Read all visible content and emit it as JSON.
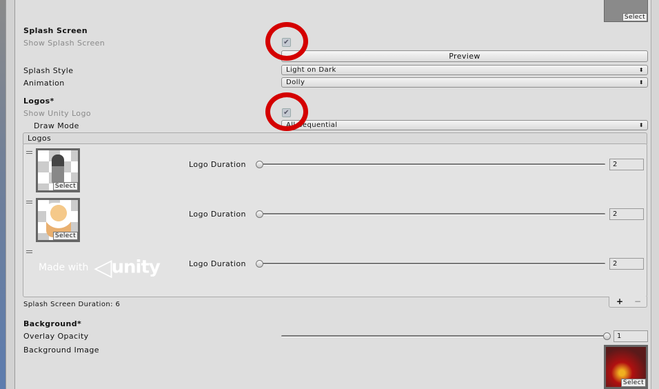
{
  "top_thumbnail": {
    "select_label": "Select"
  },
  "splash": {
    "section_title": "Splash Screen",
    "show_splash_label": "Show Splash Screen",
    "show_splash_checked": true,
    "preview_label": "Preview",
    "style_label": "Splash Style",
    "style_value": "Light on Dark",
    "animation_label": "Animation",
    "animation_value": "Dolly"
  },
  "logos": {
    "section_title": "Logos*",
    "show_unity_label": "Show Unity Logo",
    "show_unity_checked": true,
    "draw_mode_label": "Draw Mode",
    "draw_mode_value": "All Sequential",
    "list_title": "Logos",
    "items": [
      {
        "duration_label": "Logo Duration",
        "duration": "2",
        "select_label": "Select"
      },
      {
        "duration_label": "Logo Duration",
        "duration": "2",
        "select_label": "Select"
      },
      {
        "duration_label": "Logo Duration",
        "duration": "2",
        "logo_text": "Made with unity"
      }
    ],
    "add_label": "+",
    "remove_label": "−",
    "total_label": "Splash Screen Duration: 6"
  },
  "background": {
    "section_title": "Background*",
    "opacity_label": "Overlay Opacity",
    "opacity": "1",
    "image_label": "Background Image",
    "select_label": "Select"
  },
  "colors": {
    "annotation_ring": "#d40000"
  }
}
